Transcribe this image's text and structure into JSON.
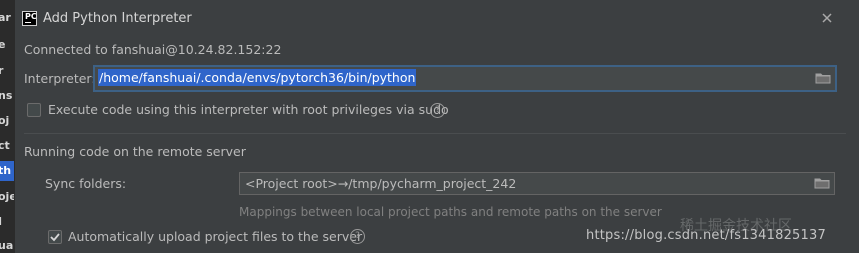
{
  "window": {
    "title": "Add Python Interpreter"
  },
  "connection": {
    "text": "Connected to fanshuai@10.24.82.152:22"
  },
  "interpreter": {
    "label": "Interpreter:",
    "value": "/home/fanshuai/.conda/envs/pytorch36/bin/python"
  },
  "sudo_option": {
    "label": "Execute code using this interpreter with root privileges via sudo",
    "checked": false
  },
  "remote_section": {
    "title": "Running code on the remote server",
    "sync_label": "Sync folders:",
    "sync_value": "<Project root>→/tmp/pycharm_project_242",
    "hint": "Mappings between local project paths and remote paths on the server",
    "auto_upload_label": "Automatically upload project files to the server",
    "auto_upload_checked": true
  },
  "background_fragments": [
    "ar",
    "e",
    "r",
    "ns",
    "oj",
    "ct",
    "th",
    "oje",
    "I",
    "ua"
  ],
  "watermark": {
    "text": "https://blog.csdn.net/fs1341825137",
    "back_text": "稀土掘金技术社区"
  },
  "icons": {
    "app": "pycharm-icon",
    "close": "close-icon",
    "folder": "folder-icon",
    "help": "help-icon"
  },
  "colors": {
    "dialog_bg": "#3c3f41",
    "selection": "#2f65ca",
    "field_bg": "#45494a",
    "focus_border": "#3d6185"
  }
}
